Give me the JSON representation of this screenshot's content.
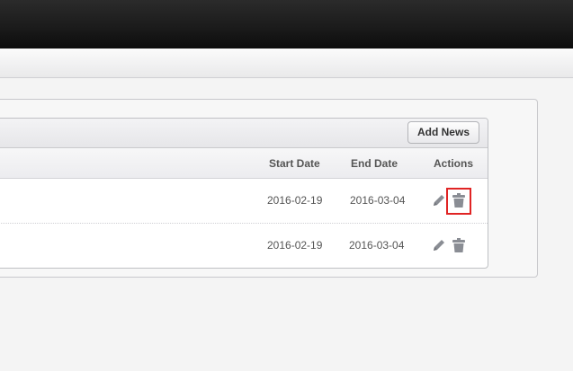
{
  "toolbar": {
    "add_news_label": "Add News"
  },
  "table": {
    "headers": {
      "start_date": "Start Date",
      "end_date": "End Date",
      "actions": "Actions"
    },
    "rows": [
      {
        "start_date": "2016-02-19",
        "end_date": "2016-03-04"
      },
      {
        "start_date": "2016-02-19",
        "end_date": "2016-03-04"
      }
    ]
  },
  "icons": {
    "edit": "pencil-icon",
    "delete": "trash-icon"
  },
  "colors": {
    "topbar": "#1a1a1a",
    "icon": "#8a8d94",
    "highlight": "#e02424"
  }
}
